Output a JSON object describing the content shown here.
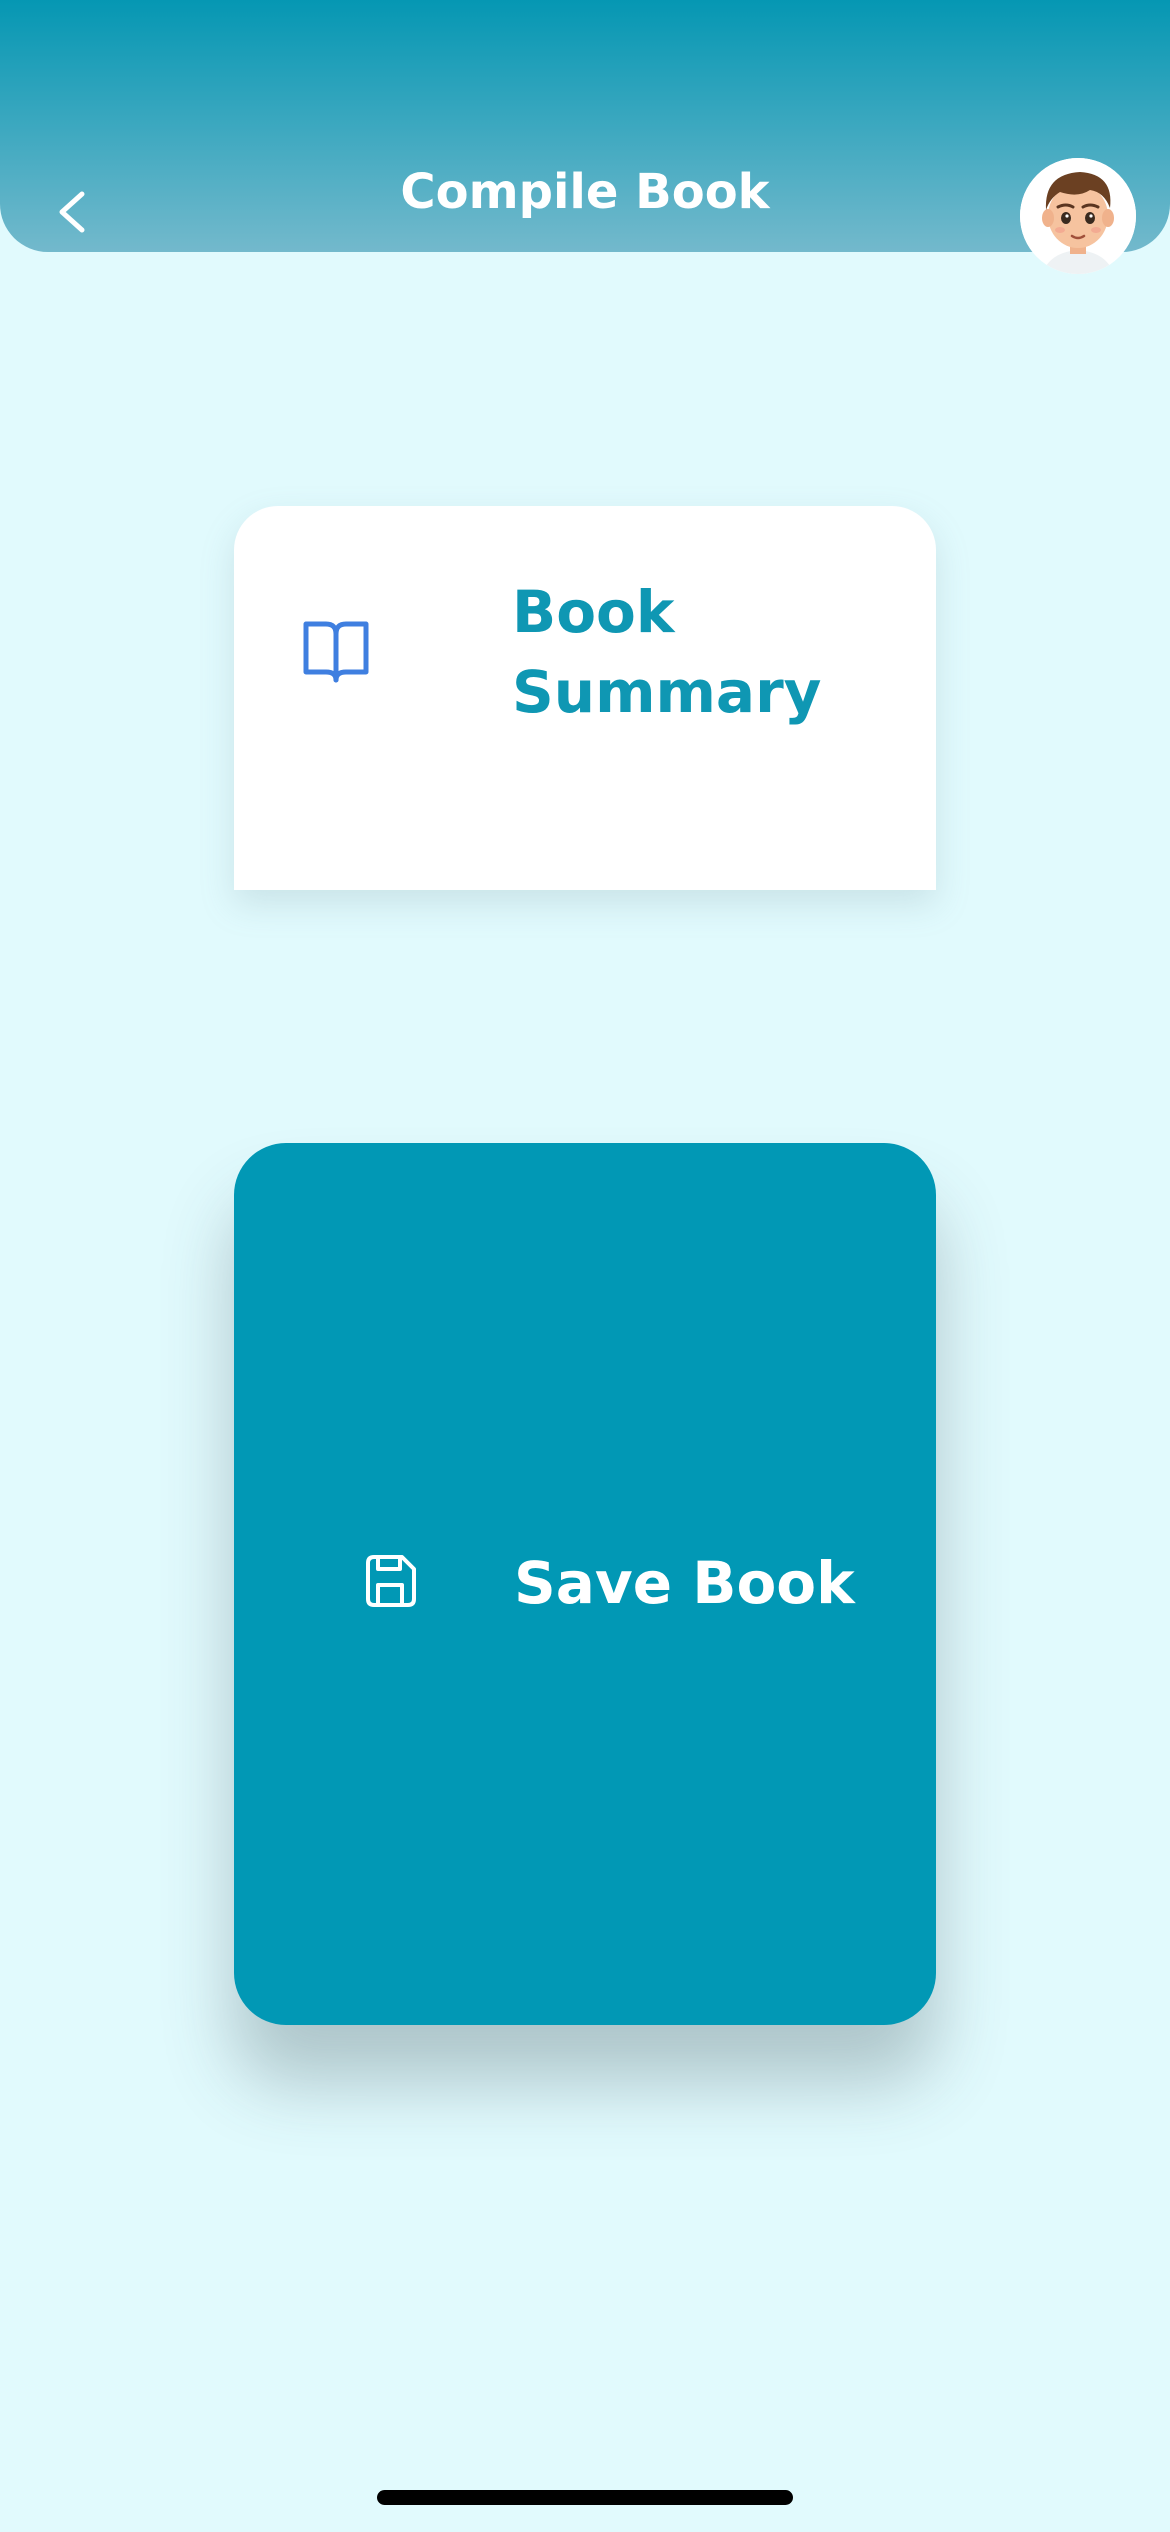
{
  "header": {
    "title": "Compile Book",
    "back_icon": "chevron-left-icon",
    "avatar_icon": "user-avatar-icon"
  },
  "summary_card": {
    "label": "Book Summary",
    "icon": "book-open-icon",
    "icon_color": "#3f7fe0",
    "text_color": "#0f97b3"
  },
  "save_card": {
    "label": "Save Book",
    "icon": "save-icon",
    "background": "#0198b5"
  },
  "colors": {
    "page_background": "#e1fafd",
    "header_top": "#0597b3",
    "header_bottom": "#73b9cc"
  }
}
